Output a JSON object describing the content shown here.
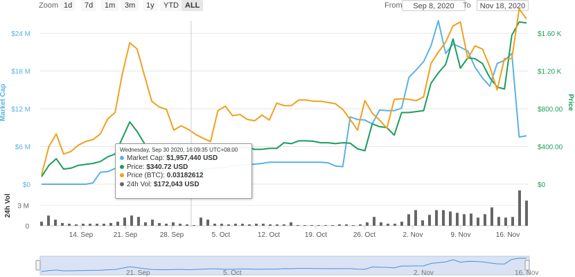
{
  "toolbar": {
    "zoom_label": "Zoom",
    "zoom_buttons": [
      "1d",
      "7d",
      "1m",
      "3m",
      "1y",
      "YTD",
      "ALL"
    ],
    "active_zoom": "ALL",
    "from_label": "From",
    "from_value": "Sep 8, 2020",
    "to_label": "To",
    "to_value": "Nov 18, 2020"
  },
  "tooltip": {
    "date": "Wednesday, Sep 30 2020, 16:09:35 UTC+08:00",
    "rows": [
      {
        "label": "Market Cap:",
        "value": "$1,957,440 USD",
        "color": "#5ab1e6"
      },
      {
        "label": "Price:",
        "value": "$340.72 USD",
        "color": "#1a9d5c"
      },
      {
        "label": "Price (BTC):",
        "value": "0.03182612",
        "color": "#f0a01e"
      },
      {
        "label": "24h Vol:",
        "value": "$172,043 USD",
        "color": "#666666"
      }
    ]
  },
  "chart_data": {
    "type": "line",
    "colors": {
      "market_cap": "#5ab1e6",
      "price": "#1a9d5c",
      "price_btc": "#f0a01e",
      "volume": "#666666"
    },
    "x_range": [
      "2020-09-08",
      "2020-11-18"
    ],
    "x_ticks": [
      "14. Sep",
      "21. Sep",
      "28. Sep",
      "5. Oct",
      "12. Oct",
      "19. Oct",
      "26. Oct",
      "2. Nov",
      "9. Nov",
      "16. Nov"
    ],
    "left_axis": {
      "label": "Market Cap",
      "ticks": [
        "$0",
        "$6 M",
        "$12 M",
        "$18 M",
        "$24 M"
      ],
      "range": [
        0,
        26000000
      ],
      "color": "#5ab1e6"
    },
    "right_axis": {
      "label": "Price",
      "ticks": [
        "$0",
        "$400.00",
        "$800.00",
        "$1.20 K",
        "$1.60 K"
      ],
      "range": [
        0,
        1733
      ],
      "color": "#1a9d5c"
    },
    "volume_axis": {
      "label": "24h Vol",
      "ticks": [
        "0",
        "3 M"
      ],
      "range": [
        0,
        5500000
      ]
    },
    "series": [
      {
        "name": "Market Cap",
        "key": "market_cap",
        "axis": "left",
        "values": [
          0,
          0,
          0,
          0,
          0,
          0,
          0,
          200000,
          1900000,
          2000000,
          2500000,
          2900000,
          2900000,
          3000000,
          2600000,
          2100000,
          2100000,
          2100000,
          2000000,
          1957440,
          2100000,
          2300000,
          2400000,
          2500000,
          2600000,
          2700000,
          2900000,
          3000000,
          3100000,
          3200000,
          3300000,
          3500000,
          3500000,
          3500000,
          3500000,
          3500000,
          3500000,
          3500000,
          3500000,
          3400000,
          2900000,
          2800000,
          10700000,
          10300000,
          10200000,
          9600000,
          11800000,
          11700000,
          11700000,
          12100000,
          17000000,
          18200000,
          19500000,
          22000000,
          26000000,
          20800000,
          22300000,
          21800000,
          21200000,
          18600000,
          16900000,
          15600000,
          19200000,
          19700000,
          20800000,
          7500000,
          7700000
        ]
      },
      {
        "name": "Price",
        "key": "price",
        "axis": "right",
        "values": [
          80,
          200,
          270,
          160,
          170,
          200,
          210,
          220,
          240,
          290,
          320,
          490,
          660,
          560,
          430,
          330,
          310,
          300,
          320,
          340.72,
          300,
          330,
          380,
          400,
          400,
          350,
          350,
          390,
          390,
          370,
          370,
          380,
          380,
          440,
          430,
          460,
          460,
          455,
          440,
          440,
          430,
          440,
          435,
          375,
          355,
          640,
          610,
          600,
          520,
          760,
          760,
          770,
          780,
          1070,
          1180,
          1270,
          1540,
          1230,
          1340,
          1330,
          1280,
          1130,
          1030,
          1010,
          1580,
          1720,
          1710
        ]
      },
      {
        "name": "Price (BTC)",
        "key": "price_btc",
        "axis": "left",
        "values": [
          1500000,
          6000000,
          8000000,
          4800000,
          5200000,
          6200000,
          6800000,
          7100000,
          8000000,
          10400000,
          11400000,
          17600000,
          22500000,
          21500000,
          17300000,
          13200000,
          12300000,
          11900000,
          8600000,
          9300000,
          8700000,
          7900000,
          7300000,
          6800000,
          11700000,
          12400000,
          10900000,
          11100000,
          10300000,
          10100000,
          11000000,
          10200000,
          12900000,
          12500000,
          12500000,
          13400000,
          13400000,
          13200000,
          13200000,
          13000000,
          12800000,
          11900000,
          10300000,
          8600000,
          13300000,
          11300000,
          10200000,
          8900000,
          13500000,
          13600000,
          13500000,
          13300000,
          13900000,
          19200000,
          21000000,
          22600000,
          25200000,
          25800000,
          20000000,
          22000000,
          21500000,
          18700000,
          15000000,
          20000000,
          20000000,
          27900000,
          26300000
        ]
      },
      {
        "name": "24h Vol",
        "key": "volume",
        "axis": "volume",
        "values": [
          600000,
          1500000,
          900000,
          400000,
          300000,
          200000,
          300000,
          300000,
          300000,
          300000,
          400000,
          600000,
          1200000,
          1500000,
          1300000,
          500000,
          900000,
          400000,
          300000,
          500000,
          300000,
          200000,
          100000,
          1200000,
          900000,
          300000,
          300000,
          200000,
          300000,
          300000,
          200000,
          300000,
          300000,
          200000,
          200000,
          200000,
          500000,
          100000,
          100000,
          100000,
          100000,
          100000,
          100000,
          200000,
          200000,
          100000,
          200000,
          500000,
          1300000,
          500000,
          300000,
          300000,
          600000,
          1700000,
          2300000,
          800000,
          1600000,
          2300000,
          2300000,
          2100000,
          1900000,
          1700000,
          1800000,
          1200000,
          1700000,
          2700000,
          1300000,
          1200000,
          1300000,
          5200000,
          3700000
        ]
      }
    ],
    "navigator": {
      "x_ticks": [
        "21. Sep",
        "5. Oct",
        "2. Nov",
        "16. Nov"
      ]
    }
  }
}
